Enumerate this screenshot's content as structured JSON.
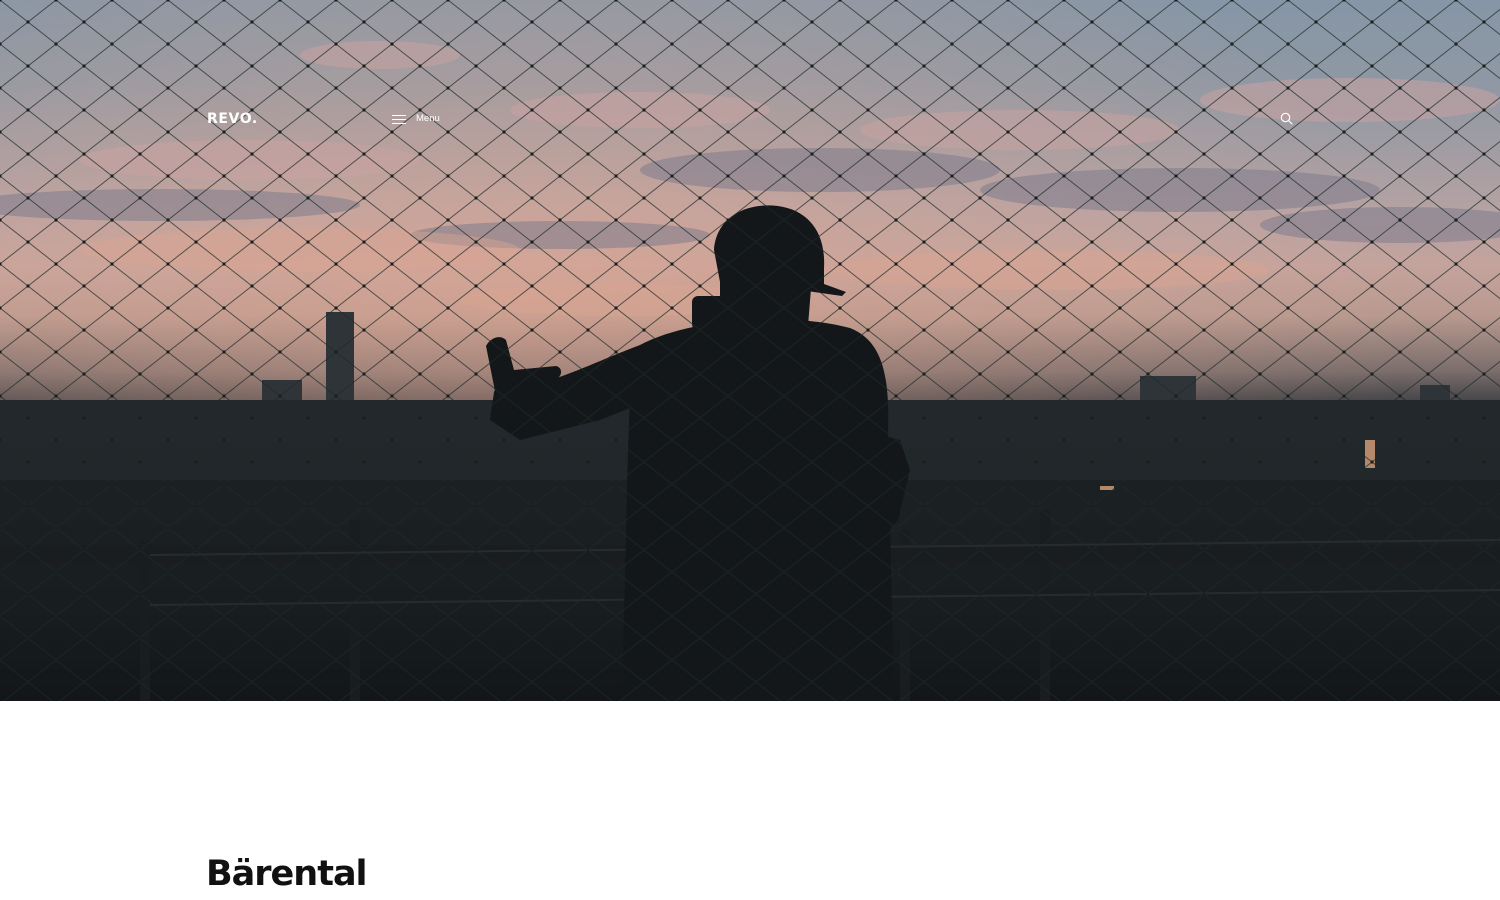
{
  "header": {
    "logo_text": "REVO.",
    "menu_label": "Menu",
    "icons": {
      "menu": "hamburger-icon",
      "search": "search-icon"
    }
  },
  "hero": {
    "image_subject": "silhouette-behind-net-at-dusk"
  },
  "content": {
    "title": "Bärental"
  },
  "colors": {
    "header_text": "#ffffff",
    "title_text": "#111111",
    "page_background": "#ffffff"
  }
}
